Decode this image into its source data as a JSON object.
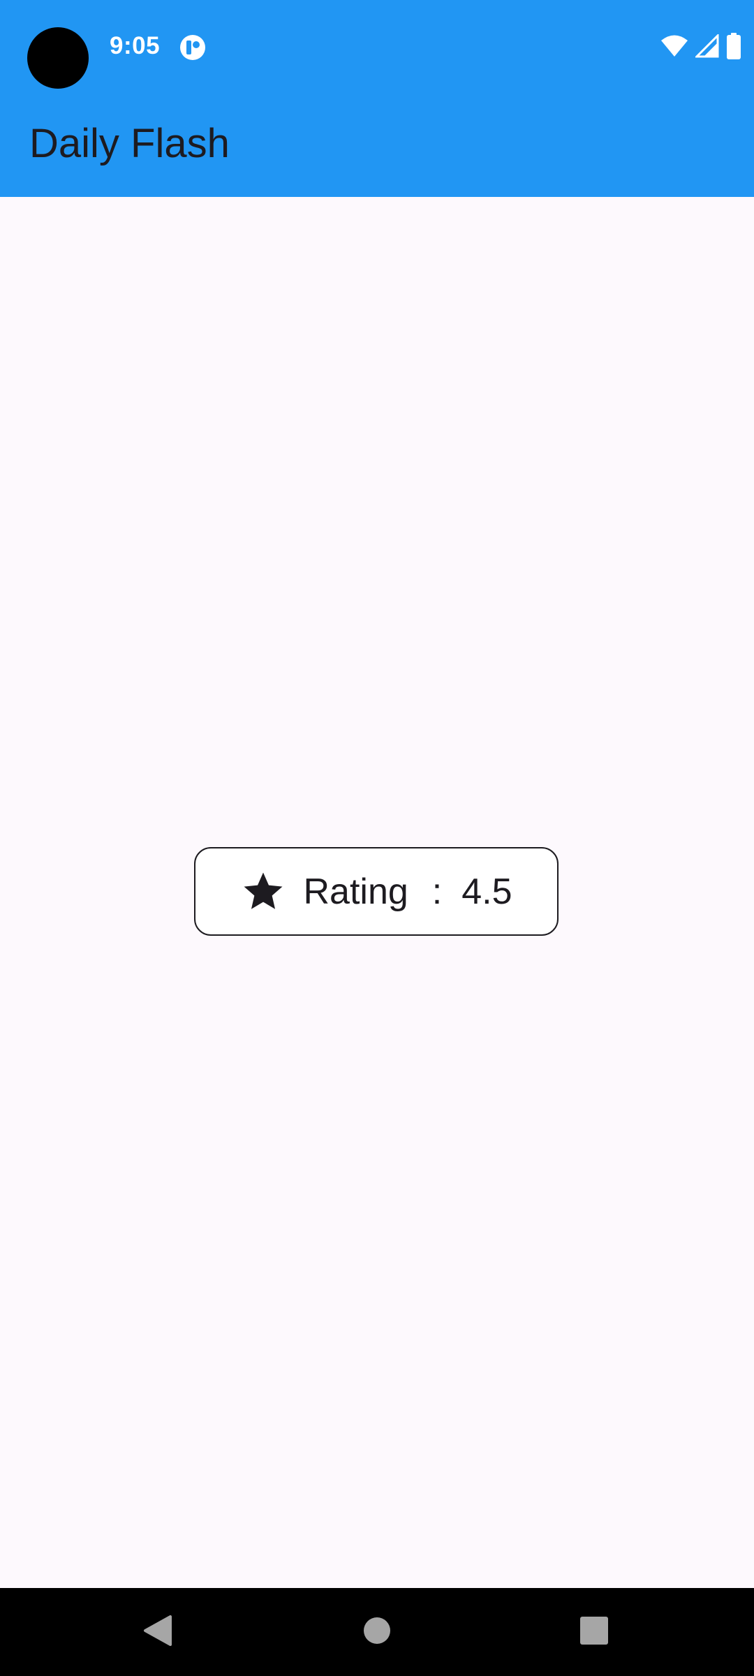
{
  "status_bar": {
    "time": "9:05",
    "notification_icon": "app-notification-icon",
    "icons": [
      "wifi-icon",
      "cellular-signal-icon",
      "battery-icon"
    ]
  },
  "app_bar": {
    "title": "Daily Flash",
    "background_color": "#2196F3"
  },
  "rating": {
    "icon": "star-icon",
    "label": "Rating",
    "separator": ":",
    "value": "4.5"
  },
  "nav_bar": {
    "buttons": [
      "back-icon",
      "home-icon",
      "recents-icon"
    ]
  }
}
